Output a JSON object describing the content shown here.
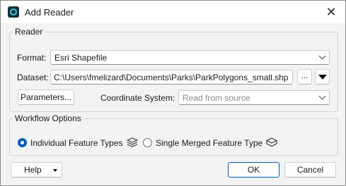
{
  "window": {
    "title": "Add Reader",
    "close_symbol": "✕",
    "app_icon": "fme-app-icon"
  },
  "reader": {
    "group_label": "Reader",
    "format_label": "Format:",
    "format_value": "Esri Shapefile",
    "dataset_label": "Dataset:",
    "dataset_value": "C:\\Users\\fmelizard\\Documents\\Parks\\ParkPolygons_small.shp",
    "browse_label": "...",
    "parameters_label": "Parameters...",
    "coord_label": "Coordinate System:",
    "coord_placeholder": "Read from source"
  },
  "workflow": {
    "group_label": "Workflow Options",
    "option_individual": "Individual Feature Types",
    "option_merged": "Single Merged Feature Type",
    "selected": "individual"
  },
  "footer": {
    "help_label": "Help",
    "ok_label": "OK",
    "cancel_label": "Cancel"
  },
  "colors": {
    "accent": "#005fb8",
    "dialog_bg": "#f3f3f3"
  }
}
